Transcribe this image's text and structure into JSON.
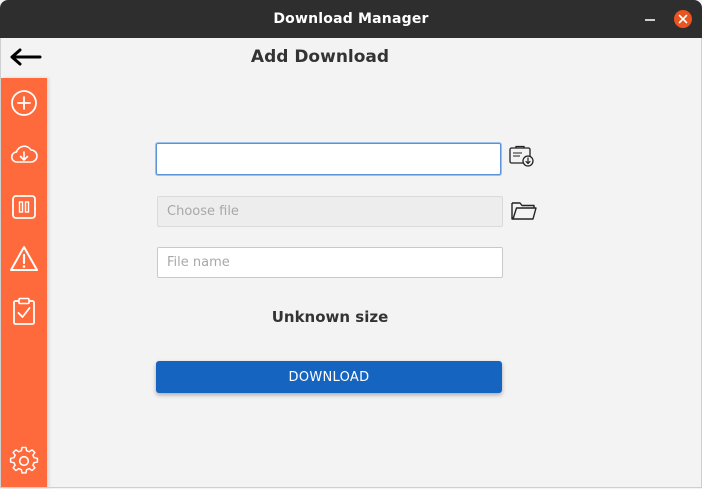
{
  "window": {
    "title": "Download Manager"
  },
  "header": {
    "title": "Add Download",
    "back_icon": "arrow-left-icon"
  },
  "sidebar": {
    "color": "#ff6a3d",
    "items": [
      {
        "name": "add",
        "icon": "plus-circle-icon"
      },
      {
        "name": "downloading",
        "icon": "cloud-download-icon"
      },
      {
        "name": "paused",
        "icon": "pause-icon"
      },
      {
        "name": "failed",
        "icon": "warning-icon"
      },
      {
        "name": "completed",
        "icon": "clipboard-check-icon"
      },
      {
        "name": "settings",
        "icon": "gear-icon"
      }
    ]
  },
  "form": {
    "url": {
      "value": "",
      "placeholder": ""
    },
    "save_location": {
      "value": "",
      "placeholder": "Choose file"
    },
    "file_name": {
      "value": "",
      "placeholder": "File name"
    },
    "size_text": "Unknown size",
    "download_label": "DOWNLOAD",
    "paste_icon": "clipboard-paste-icon",
    "folder_icon": "folder-icon"
  },
  "colors": {
    "accent": "#1565c0",
    "close": "#e95420",
    "titlebar": "#2e2e2e"
  }
}
